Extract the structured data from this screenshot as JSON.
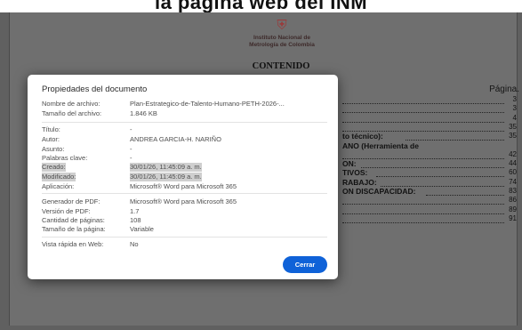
{
  "caption": "la página web del INM",
  "pdf_page": {
    "seal_icon": "colombia-coat-of-arms",
    "institution_line1": "Instituto Nacional de",
    "institution_line2": "Metrología de Colombia",
    "heading": "CONTENIDO",
    "page_column_label": "Página.",
    "toc": [
      {
        "text": "",
        "page": "3"
      },
      {
        "text": "",
        "page": "3"
      },
      {
        "text": "",
        "page": "4"
      },
      {
        "text": "",
        "page": "35"
      },
      {
        "text": "to técnico):",
        "page": "35"
      },
      {
        "text": "ANO (Herramienta de",
        "page": ""
      },
      {
        "text": "",
        "page": "42"
      },
      {
        "text": "ON:",
        "page": "44"
      },
      {
        "text": "TIVOS:",
        "page": "60"
      },
      {
        "text": "RABAJO:",
        "page": "74"
      },
      {
        "text": "ON DISCAPACIDAD:",
        "page": "83"
      },
      {
        "text": "",
        "page": "86"
      },
      {
        "text": "",
        "page": "89"
      },
      {
        "text": "",
        "page": "91"
      }
    ]
  },
  "dialog": {
    "title": "Propiedades del documento",
    "file_name_label": "Nombre de archivo:",
    "file_name_value": "Plan-Estrategico-de-Talento-Humano-PETH-2026-...",
    "file_size_label": "Tamaño del archivo:",
    "file_size_value": "1.846 KB",
    "title_label": "Título:",
    "title_value": "-",
    "author_label": "Autor:",
    "author_value": "ANDREA GARCIA-H. NARIÑO",
    "subject_label": "Asunto:",
    "subject_value": "-",
    "keywords_label": "Palabras clave:",
    "keywords_value": "-",
    "created_label": "Creado:",
    "created_value": "30/01/26, 11:45:09 a. m.",
    "modified_label": "Modificado:",
    "modified_value": "30/01/26, 11:45:09 a. m.",
    "application_label": "Aplicación:",
    "application_value": "Microsoft® Word para Microsoft 365",
    "pdf_producer_label": "Generador de PDF:",
    "pdf_producer_value": "Microsoft® Word para Microsoft 365",
    "pdf_version_label": "Versión de PDF:",
    "pdf_version_value": "1.7",
    "page_count_label": "Cantidad de páginas:",
    "page_count_value": "108",
    "page_size_label": "Tamaño de la página:",
    "page_size_value": "Variable",
    "fast_web_view_label": "Vista rápida en Web:",
    "fast_web_view_value": "No",
    "close_label": "Cerrar"
  },
  "colors": {
    "accent": "#0f62d8",
    "overlay": "#606060",
    "highlight": "#cfcfcf"
  }
}
